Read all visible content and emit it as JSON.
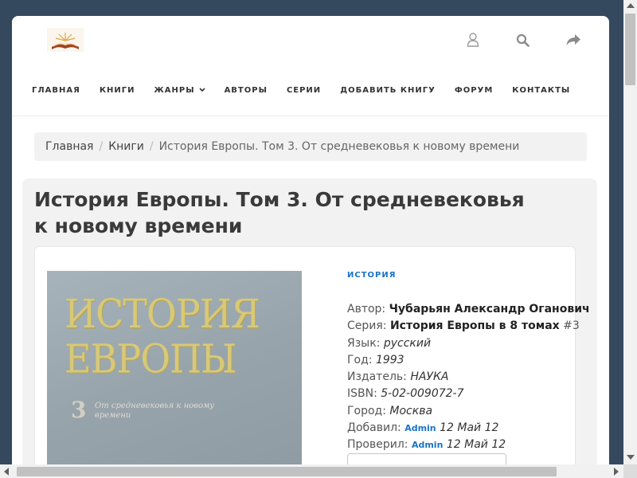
{
  "header": {
    "logo_icon": "open-book-icon",
    "icons": [
      "user-icon",
      "search-icon",
      "share-icon"
    ]
  },
  "nav": {
    "items": [
      {
        "label": "ГЛАВНАЯ"
      },
      {
        "label": "КНИГИ"
      },
      {
        "label": "ЖАНРЫ",
        "dropdown": true
      },
      {
        "label": "АВТОРЫ"
      },
      {
        "label": "СЕРИИ"
      },
      {
        "label": "ДОБАВИТЬ КНИГУ"
      },
      {
        "label": "ФОРУМ"
      },
      {
        "label": "КОНТАКТЫ"
      }
    ]
  },
  "breadcrumb": {
    "home": "Главная",
    "books": "Книги",
    "current": "История Европы. Том 3. От средневековья к новому времени"
  },
  "book": {
    "title": "История Европы. Том 3. От средневековья к новому времени",
    "genre": "ИСТОРИЯ",
    "cover": {
      "title_line1": "ИСТОРИЯ",
      "title_line2": "ЕВРОПЫ",
      "volume": "3",
      "subtitle": "От средневековья к новому времени"
    },
    "author_label": "Автор:",
    "author": "Чубарьян Александр Оганович",
    "series_label": "Серия:",
    "series": "История Европы в 8 томах",
    "series_number": "#3",
    "language_label": "Язык:",
    "language": "русский",
    "year_label": "Год:",
    "year": "1993",
    "publisher_label": "Издатель:",
    "publisher": "НАУКА",
    "isbn_label": "ISBN:",
    "isbn": "5-02-009072-7",
    "city_label": "Город:",
    "city": "Москва",
    "added_label": "Добавил:",
    "added_by": "Admin",
    "added_date": "12 Май 12",
    "checked_label": "Проверил:",
    "checked_by": "Admin",
    "checked_date": "12 Май 12"
  },
  "colors": {
    "background": "#34495e",
    "accent": "#1a73c8",
    "panel": "#f2f2f2"
  }
}
